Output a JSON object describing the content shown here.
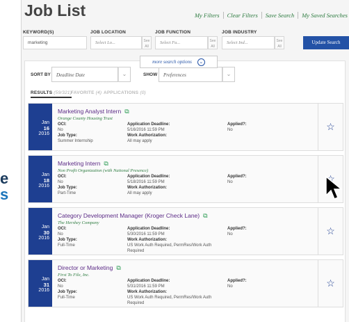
{
  "side_text": {
    "e": "e",
    "s": "s"
  },
  "page": {
    "title": "Job List"
  },
  "top_links": [
    "My Filters",
    "Clear Filters",
    "Save Search",
    "My Saved Searches"
  ],
  "search": {
    "keywords": {
      "label": "KEYWORD(S)",
      "value": "marketing"
    },
    "location": {
      "label": "JOB LOCATION",
      "placeholder": "Select Lo...",
      "see_all": "See All"
    },
    "function": {
      "label": "JOB FUNCTION",
      "placeholder": "Select Fu...",
      "see_all": "See All"
    },
    "industry": {
      "label": "JOB INDUSTRY",
      "placeholder": "Select Ind...",
      "see_all": "See All"
    },
    "update_label": "Update Search",
    "more_options_label": "more search options"
  },
  "sort": {
    "label": "SORT BY",
    "value": "Deadline Date",
    "show_label": "SHOW",
    "show_value": "Preferences"
  },
  "tabs": [
    {
      "label": "RESULTS",
      "count": "(59/321)"
    },
    {
      "label": "FAVORITE",
      "count": "(4)"
    },
    {
      "label": "APPLICATIONS",
      "count": "(0)"
    }
  ],
  "field_labels": {
    "oci": "OCI:",
    "deadline": "Application Deadline:",
    "applied": "Applied?:",
    "job_type": "Job Type:",
    "work_auth": "Work Authorization:"
  },
  "jobs": [
    {
      "month": "Jan",
      "day": "16",
      "year": "2016",
      "title": "Marketing Analyst Intern",
      "employer": "Orange County Housing Trust",
      "oci": "No",
      "deadline": "5/16/2016 11:59 PM",
      "applied": "No",
      "job_type": "Summer Internship",
      "work_auth": "All may apply"
    },
    {
      "month": "Jan",
      "day": "18",
      "year": "2016",
      "title": "Marketing Intern",
      "employer": "Non Profit Organization (with National Presence)",
      "oci": "No",
      "deadline": "5/18/2016 11:59 PM",
      "applied": "No",
      "job_type": "Part-Time",
      "work_auth": "All may apply"
    },
    {
      "month": "Jan",
      "day": "30",
      "year": "2016",
      "title": "Category Development Manager (Kroger Check Lane)",
      "employer": "The Hershey Company",
      "oci": "No",
      "deadline": "5/30/2016 11:59 PM",
      "applied": "No",
      "job_type": "Full-Time",
      "work_auth": "US Work Auth Required, PermRes/Work Auth Required"
    },
    {
      "month": "Jan",
      "day": "31",
      "year": "2016",
      "title": "Director or Marketing",
      "employer": "First To File, Inc.",
      "oci": "No",
      "deadline": "5/31/2016 11:59 PM",
      "applied": "No",
      "job_type": "Full-Time",
      "work_auth": "US Work Auth Required, PermRes/Work Auth Required"
    }
  ],
  "colors": {
    "accent": "#2352a6",
    "date_bg": "#1e3f91",
    "title": "#5b2a86",
    "employer": "#2b7a3e"
  },
  "icons": {
    "star": "star-outline-icon",
    "external": "external-link-icon",
    "chevron": "chevron-down-icon",
    "cursor": "mouse-pointer-icon"
  }
}
